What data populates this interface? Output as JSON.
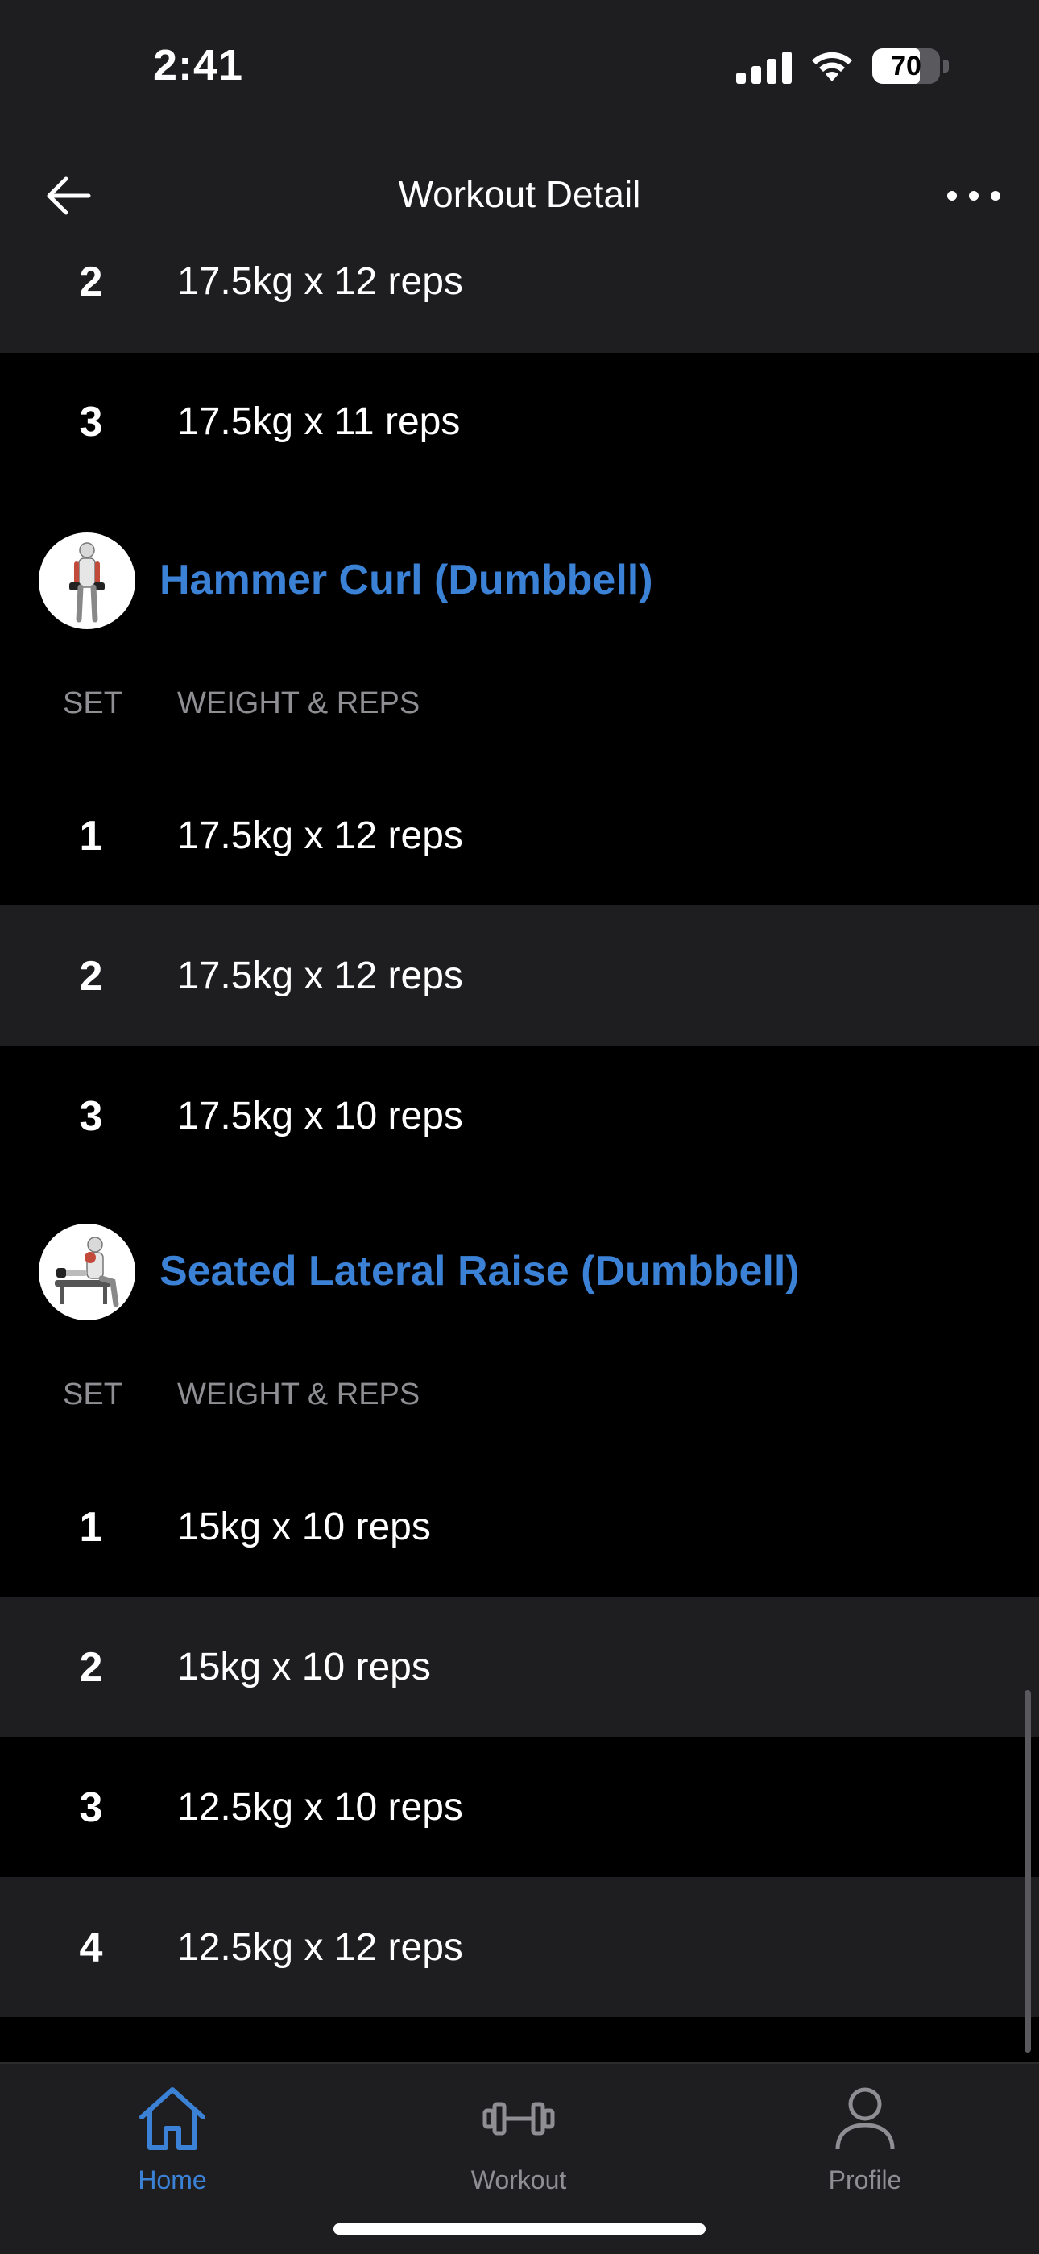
{
  "status": {
    "time": "2:41",
    "battery": "70"
  },
  "header": {
    "title": "Workout Detail"
  },
  "column_labels": {
    "set": "SET",
    "weight_reps": "WEIGHT & REPS"
  },
  "top_rows": [
    {
      "set": "2",
      "value": "17.5kg x 12 reps"
    },
    {
      "set": "3",
      "value": "17.5kg x 11 reps"
    }
  ],
  "exercises": [
    {
      "name": "Hammer Curl (Dumbbell)",
      "sets": [
        {
          "set": "1",
          "value": "17.5kg x 12 reps"
        },
        {
          "set": "2",
          "value": "17.5kg x 12 reps"
        },
        {
          "set": "3",
          "value": "17.5kg x 10 reps"
        }
      ]
    },
    {
      "name": "Seated Lateral Raise (Dumbbell)",
      "sets": [
        {
          "set": "1",
          "value": "15kg x 10 reps"
        },
        {
          "set": "2",
          "value": "15kg x 10 reps"
        },
        {
          "set": "3",
          "value": "12.5kg x 10 reps"
        },
        {
          "set": "4",
          "value": "12.5kg x 12 reps"
        }
      ]
    }
  ],
  "tabs": [
    {
      "label": "Home",
      "icon": "home-icon",
      "active": true
    },
    {
      "label": "Workout",
      "icon": "dumbbell-icon",
      "active": false
    },
    {
      "label": "Profile",
      "icon": "person-icon",
      "active": false
    }
  ],
  "colors": {
    "accent": "#3b82d6",
    "row_alt": "#1e1e20",
    "muted": "#8e8e93"
  }
}
